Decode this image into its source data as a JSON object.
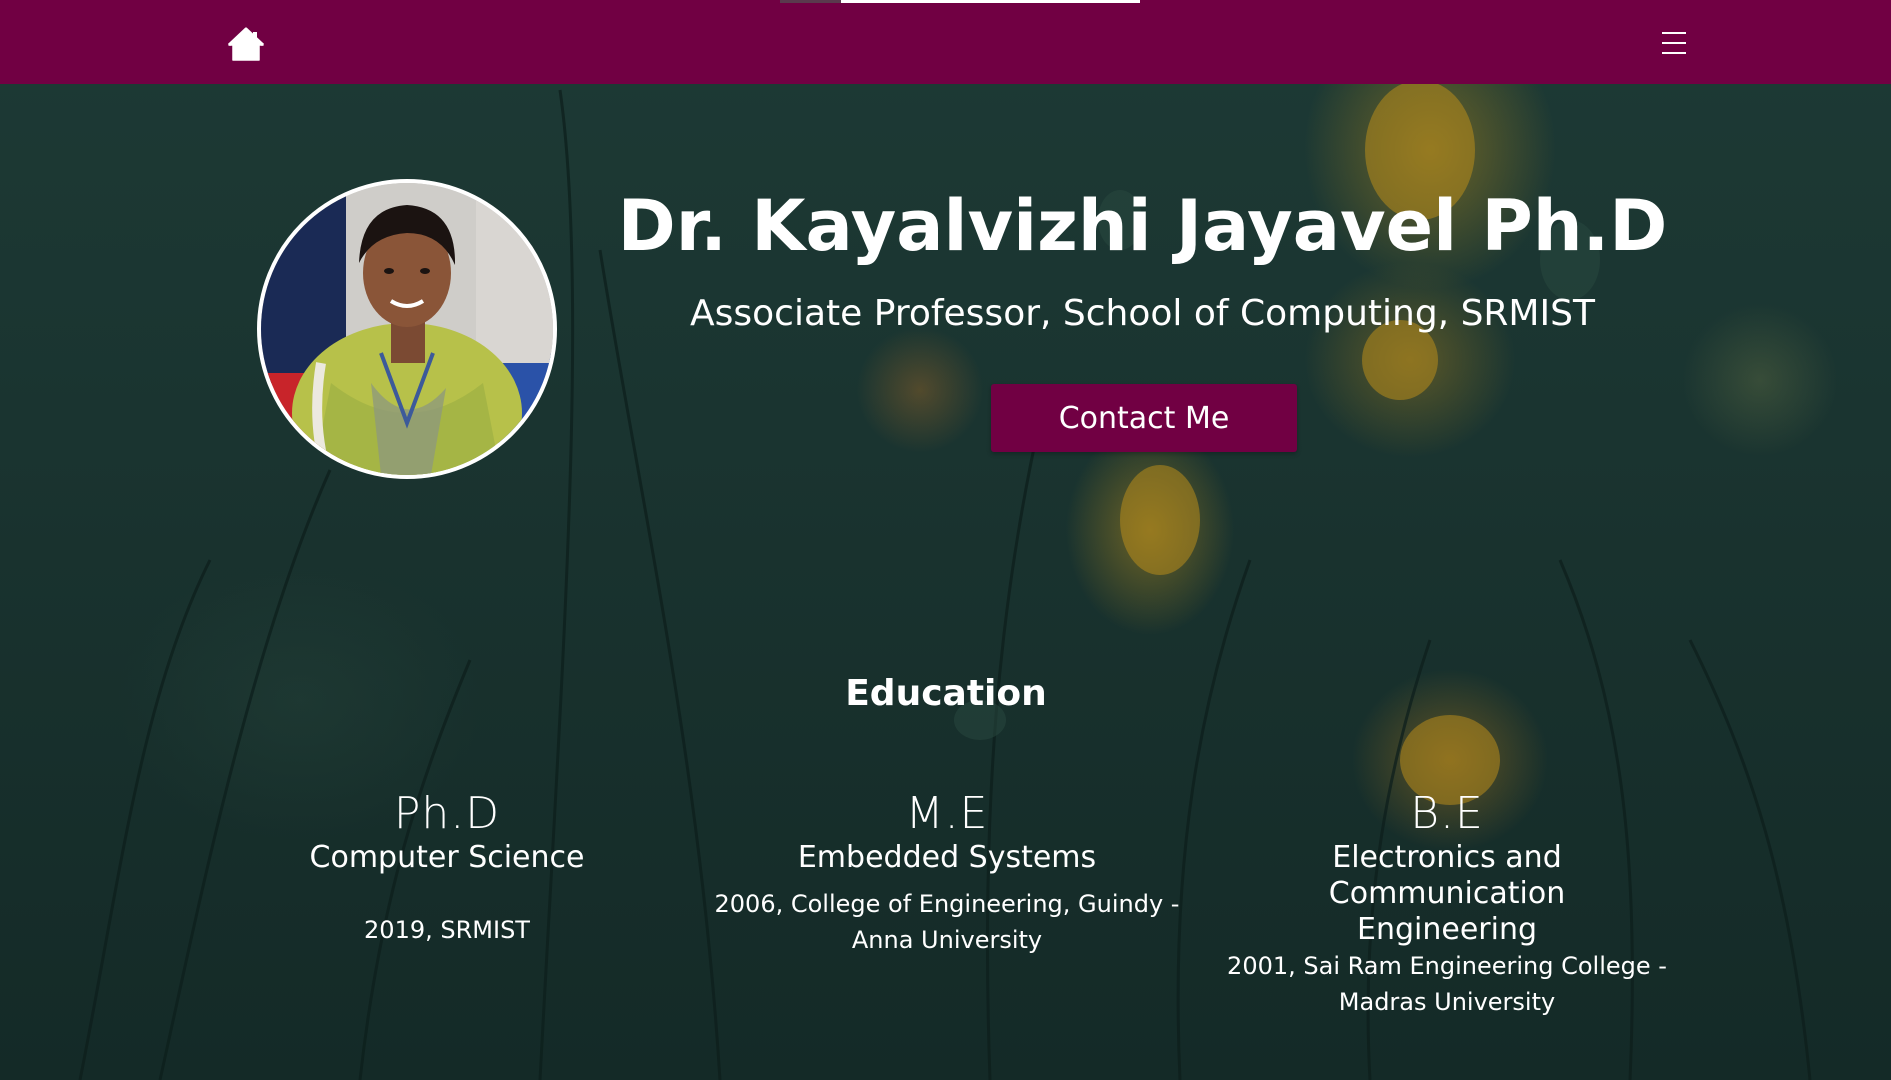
{
  "navbar": {
    "home_icon": "home-icon",
    "menu_icon": "hamburger-menu-icon",
    "scroll_progress": 0.17,
    "background_color": "#710043"
  },
  "hero": {
    "name": "Dr. Kayalvizhi Jayavel Ph.D",
    "subtitle": "Associate Professor, School of Computing, SRMIST",
    "contact_button": "Contact Me",
    "accent_color": "#710043"
  },
  "education": {
    "heading": "Education",
    "items": [
      {
        "degree": "Ph.D",
        "field": "Computer Science",
        "detail_line1": "2019, SRMIST",
        "detail_line2": ""
      },
      {
        "degree": "M.E",
        "field": "Embedded Systems",
        "detail_line1": "2006, College of Engineering, Guindy -",
        "detail_line2": "Anna University"
      },
      {
        "degree": "B.E",
        "field_line1": "Electronics and Communication",
        "field_line2": "Engineering",
        "detail_line1": "2001, Sai Ram Engineering College -",
        "detail_line2": "Madras University"
      }
    ]
  }
}
